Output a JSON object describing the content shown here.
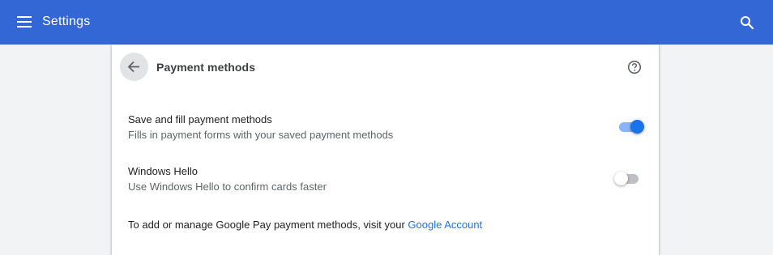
{
  "toolbar": {
    "title": "Settings",
    "menu_icon": "menu-icon",
    "search_icon": "search-icon",
    "background": "#3367d6"
  },
  "page": {
    "title": "Payment methods",
    "back_icon": "arrow-back-icon",
    "help_icon": "help-icon"
  },
  "settings": [
    {
      "label": "Save and fill payment methods",
      "sublabel": "Fills in payment forms with your saved payment methods",
      "enabled": true
    },
    {
      "label": "Windows Hello",
      "sublabel": "Use Windows Hello to confirm cards faster",
      "enabled": false
    }
  ],
  "footer": {
    "text": "To add or manage Google Pay payment methods, visit your ",
    "link_text": "Google Account"
  },
  "colors": {
    "accent": "#1a73e8",
    "toggle_track_on": "#8ab4f8"
  }
}
